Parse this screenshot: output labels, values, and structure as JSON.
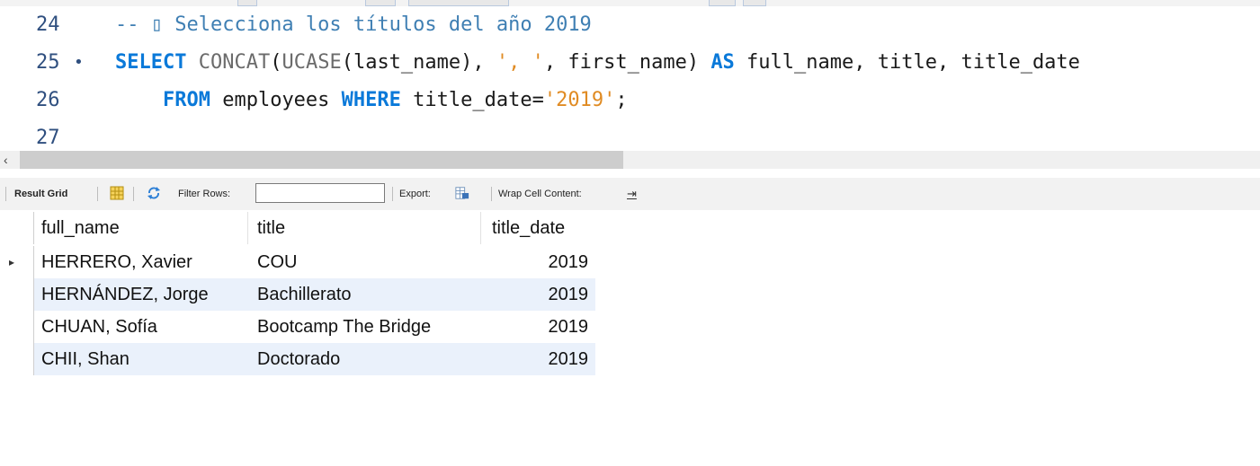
{
  "editor": {
    "lines": [
      {
        "number": "24",
        "marker": "",
        "comment": "-- ▯ Selecciona los títulos del año 2019"
      },
      {
        "number": "25",
        "marker": "•",
        "tokens": {
          "kw_select": "SELECT",
          "fn_concat": "CONCAT",
          "p1": "(",
          "fn_ucase": "UCASE",
          "p2": "(last_name), ",
          "s1": "', '",
          "p3": ", first_name) ",
          "kw_as": "AS",
          "p4": " full_name, title, title_date"
        }
      },
      {
        "number": "26",
        "marker": "",
        "tokens": {
          "indent": "    ",
          "kw_from": "FROM",
          "p1": " employees ",
          "kw_where": "WHERE",
          "p2": " title_date=",
          "s1": "'2019'",
          "p3": ";"
        }
      },
      {
        "number": "27",
        "marker": "",
        "text": ""
      }
    ]
  },
  "scrollbar": {
    "left_arrow": "‹"
  },
  "result_toolbar": {
    "result_grid_label": "Result Grid",
    "filter_rows_label": "Filter Rows:",
    "filter_value": "",
    "export_label": "Export:",
    "wrap_label": "Wrap Cell Content:",
    "wrap_glyph": "⇥"
  },
  "grid": {
    "columns": [
      "full_name",
      "title",
      "title_date"
    ],
    "current_row_marker": "▸",
    "rows": [
      {
        "full_name": "HERRERO, Xavier",
        "title": "COU",
        "title_date": "2019"
      },
      {
        "full_name": "HERNÁNDEZ, Jorge",
        "title": "Bachillerato",
        "title_date": "2019"
      },
      {
        "full_name": "CHUAN, Sofía",
        "title": "Bootcamp The Bridge",
        "title_date": "2019"
      },
      {
        "full_name": "CHII, Shan",
        "title": "Doctorado",
        "title_date": "2019"
      }
    ]
  }
}
